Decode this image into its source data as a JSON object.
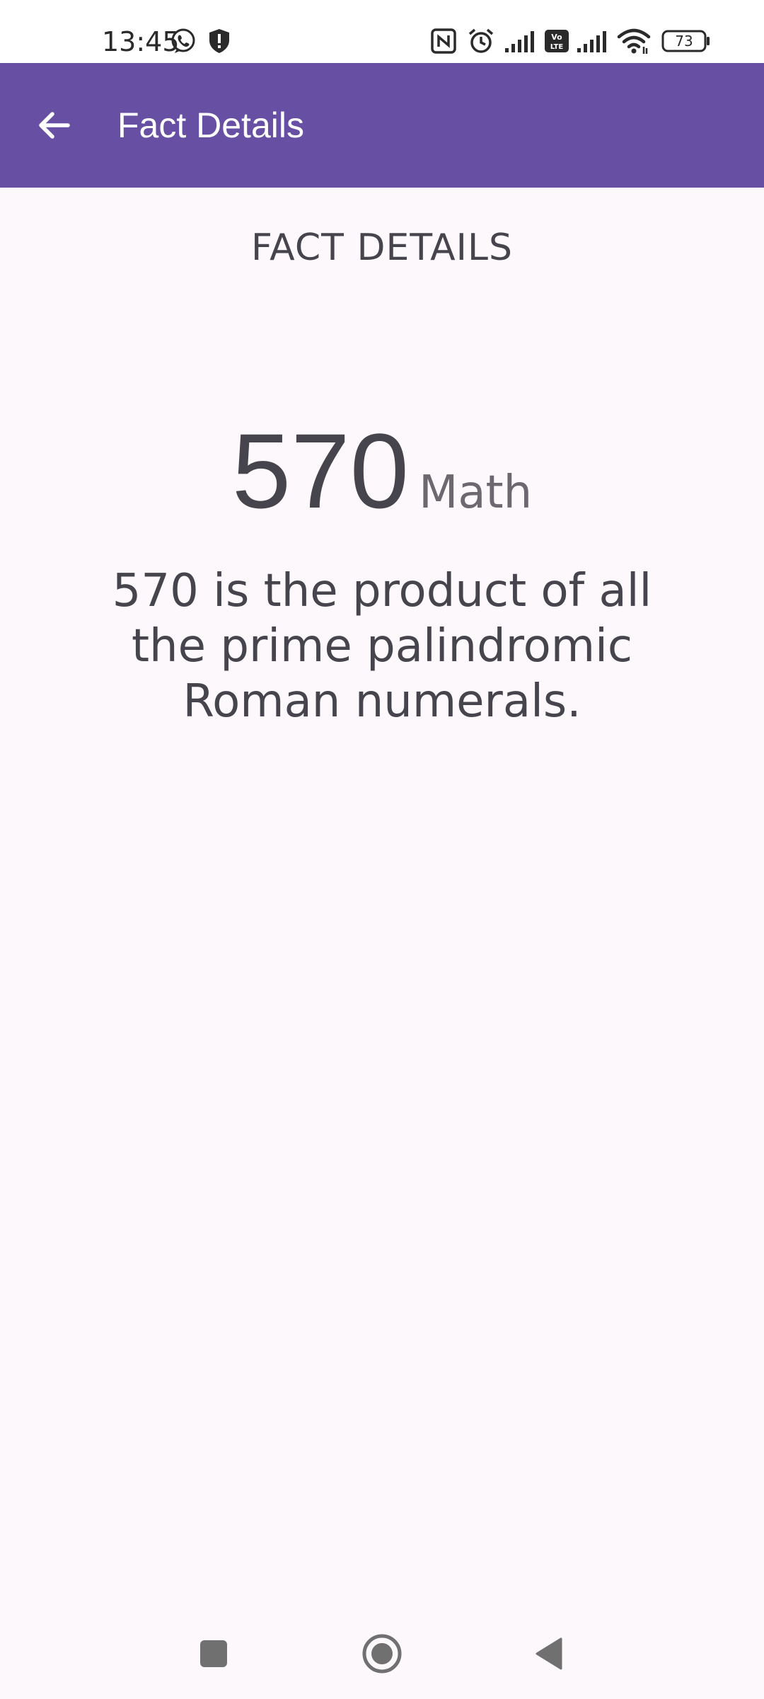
{
  "status_bar": {
    "time": "13:45",
    "battery_level": "73",
    "icons": [
      "viber-call-icon",
      "shield-alert-icon",
      "nfc-icon",
      "alarm-icon",
      "signal-icon",
      "volte-icon",
      "signal-icon",
      "wifi-icon",
      "battery-icon"
    ]
  },
  "app_bar": {
    "title": "Fact Details",
    "back_icon": "arrow-back-icon",
    "background_color": "#6750a4"
  },
  "content": {
    "heading": "FACT DETAILS",
    "number": "570",
    "type": "Math",
    "text": "570 is the product of all the prime palindromic Roman numerals."
  },
  "nav_bar": {
    "buttons": [
      "recent-apps-icon",
      "home-icon",
      "back-triangle-icon"
    ]
  }
}
